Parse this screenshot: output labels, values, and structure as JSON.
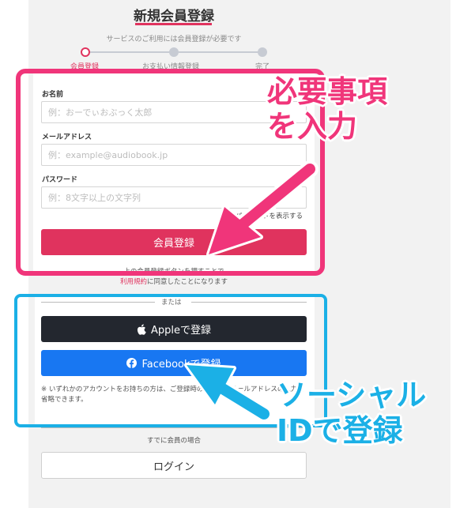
{
  "header": {
    "title": "新規会員登録",
    "subtitle": "サービスのご利用には会員登録が必要です"
  },
  "steps": [
    {
      "label": "会員登録",
      "active": true
    },
    {
      "label": "お支払い情報登録",
      "active": false
    },
    {
      "label": "完了",
      "active": false
    }
  ],
  "form": {
    "name_label": "お名前",
    "name_placeholder": "例：おーでぃおぶっく太郎",
    "email_label": "メールアドレス",
    "email_placeholder": "例：example@audiobook.jp",
    "password_label": "パスワード",
    "password_placeholder": "例：8文字以上の文字列",
    "show_password_label": "パスワードを表示する",
    "submit_label": "会員登録"
  },
  "terms": {
    "line1": "上の会員登録ボタンを押すことで",
    "link": "利用規約",
    "line2_rest": "に同意したことになります"
  },
  "social": {
    "or_label": "または",
    "apple_label": "Appleで登録",
    "facebook_label": "Facebookで登録",
    "note": "※ いずれかのアカウントをお持ちの方は、ご登録時のお名前・メールアドレスの入力を省略できます。"
  },
  "login": {
    "already_label": "すでに会員の場合",
    "login_label": "ログイン"
  },
  "annotations": {
    "pink_line1": "必要事項",
    "pink_line2": "を入力",
    "blue_line1": "ソーシャル",
    "blue_line2": "IDで登録"
  },
  "colors": {
    "accent": "#e0335e",
    "annotation_pink": "#f0357a",
    "annotation_blue": "#1bb0e6",
    "apple_button": "#23272f",
    "facebook_button": "#1877f2"
  }
}
